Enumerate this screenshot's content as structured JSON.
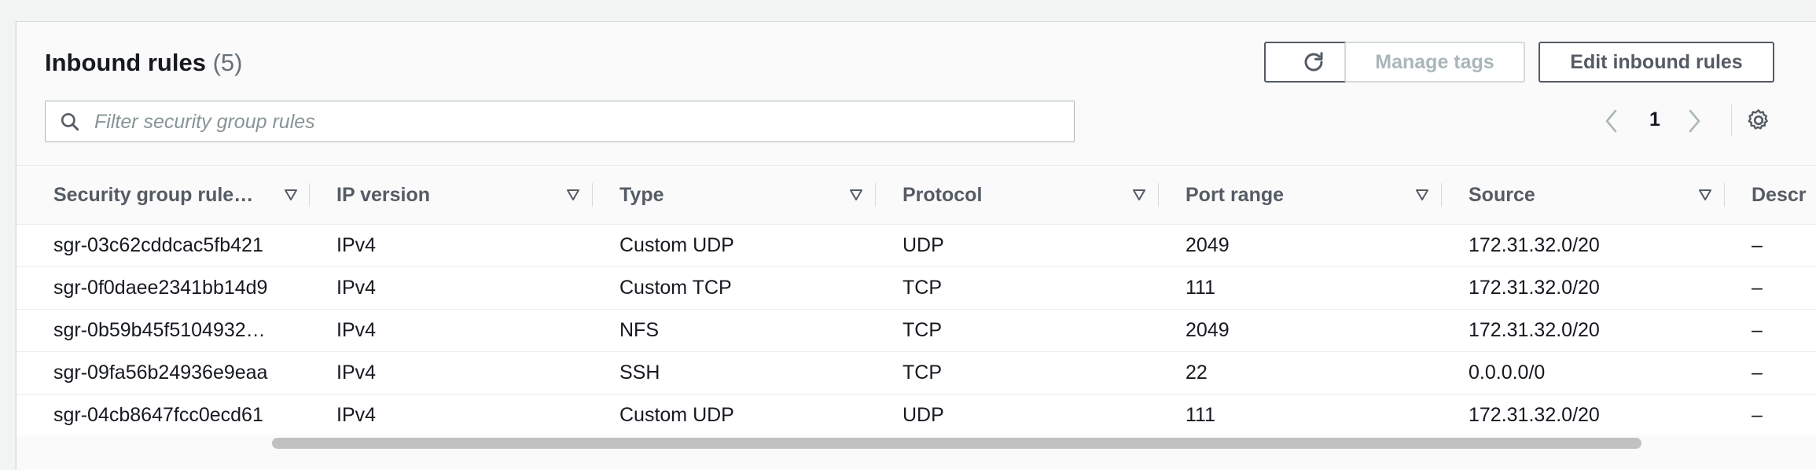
{
  "header": {
    "title": "Inbound rules",
    "count": "(5)"
  },
  "toolbar": {
    "refresh_icon": "refresh-icon",
    "manage_tags_label": "Manage tags",
    "edit_label": "Edit inbound rules"
  },
  "search": {
    "placeholder": "Filter security group rules",
    "value": ""
  },
  "pagination": {
    "current_page": "1"
  },
  "table": {
    "columns": [
      "Security group rule…",
      "IP version",
      "Type",
      "Protocol",
      "Port range",
      "Source",
      "Descr"
    ],
    "rows": [
      [
        "sgr-03c62cddcac5fb421",
        "IPv4",
        "Custom UDP",
        "UDP",
        "2049",
        "172.31.32.0/20",
        "–"
      ],
      [
        "sgr-0f0daee2341bb14d9",
        "IPv4",
        "Custom TCP",
        "TCP",
        "111",
        "172.31.32.0/20",
        "–"
      ],
      [
        "sgr-0b59b45f5104932…",
        "IPv4",
        "NFS",
        "TCP",
        "2049",
        "172.31.32.0/20",
        "–"
      ],
      [
        "sgr-09fa56b24936e9eaa",
        "IPv4",
        "SSH",
        "TCP",
        "22",
        "0.0.0.0/0",
        "–"
      ],
      [
        "sgr-04cb8647fcc0ecd61",
        "IPv4",
        "Custom UDP",
        "UDP",
        "111",
        "172.31.32.0/20",
        "–"
      ]
    ]
  },
  "colors": {
    "text": "#16191f",
    "muted": "#545b64",
    "disabled": "#aab7b8",
    "border": "#eaeded"
  }
}
